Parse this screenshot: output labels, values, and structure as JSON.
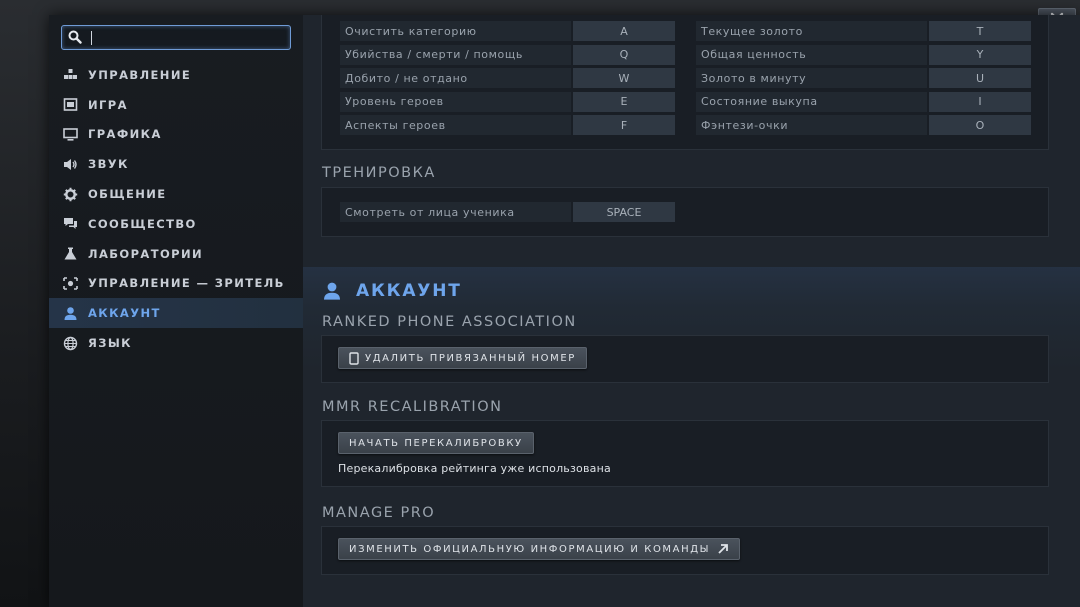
{
  "search": {
    "value": "",
    "placeholder": ""
  },
  "sidebar": {
    "items": [
      {
        "label": "УПРАВЛЕНИЕ",
        "icon": "controls-icon"
      },
      {
        "label": "ИГРА",
        "icon": "game-icon"
      },
      {
        "label": "ГРАФИКА",
        "icon": "monitor-icon"
      },
      {
        "label": "ЗВУК",
        "icon": "speaker-icon"
      },
      {
        "label": "ОБЩЕНИЕ",
        "icon": "gear-icon"
      },
      {
        "label": "СООБЩЕСТВО",
        "icon": "chat-icon"
      },
      {
        "label": "ЛАБОРАТОРИИ",
        "icon": "flask-icon"
      },
      {
        "label": "УПРАВЛЕНИЕ — ЗРИТЕЛЬ",
        "icon": "spectator-icon"
      },
      {
        "label": "АККАУНТ",
        "icon": "user-icon"
      },
      {
        "label": "ЯЗЫК",
        "icon": "globe-icon"
      }
    ],
    "active_index": 8
  },
  "hotkeys": {
    "left": [
      {
        "label": "Очистить категорию",
        "key": "A"
      },
      {
        "label": "Убийства / смерти / помощь",
        "key": "Q"
      },
      {
        "label": "Добито / не отдано",
        "key": "W"
      },
      {
        "label": "Уровень героев",
        "key": "E"
      },
      {
        "label": "Аспекты героев",
        "key": "F"
      }
    ],
    "right": [
      {
        "label": "Текущее золото",
        "key": "T"
      },
      {
        "label": "Общая ценность",
        "key": "Y"
      },
      {
        "label": "Золото в минуту",
        "key": "U"
      },
      {
        "label": "Состояние выкупа",
        "key": "I"
      },
      {
        "label": "Фэнтези-очки",
        "key": "O"
      }
    ]
  },
  "training": {
    "title": "ТРЕНИРОВКА",
    "row": {
      "label": "Смотреть от лица ученика",
      "key": "SPACE"
    }
  },
  "account": {
    "title": "АККАУНТ",
    "phone": {
      "title": "RANKED PHONE ASSOCIATION",
      "button": "УДАЛИТЬ ПРИВЯЗАННЫЙ НОМЕР"
    },
    "mmr": {
      "title": "MMR RECALIBRATION",
      "button": "НАЧАТЬ ПЕРЕКАЛИБРОВКУ",
      "note": "Перекалибровка рейтинга уже использована"
    },
    "pro": {
      "title": "MANAGE PRO",
      "button": "ИЗМЕНИТЬ ОФИЦИАЛЬНУЮ ИНФОРМАЦИЮ И КОМАНДЫ"
    }
  },
  "colors": {
    "accent": "#6ea5ec",
    "panel": "#1f252d",
    "sidebar": "#16191e"
  }
}
